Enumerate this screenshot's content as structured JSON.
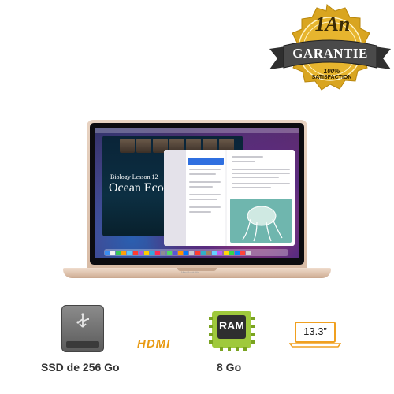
{
  "badge": {
    "years": "1An",
    "guarantee": "GARANTIE",
    "percent": "100%",
    "satisfaction": "SATISFACTION",
    "gold": "#d9a520",
    "ribbon": "#4a4a4a"
  },
  "laptop": {
    "model": "MacBook Air",
    "screen": {
      "lesson_small": "Biology Lesson 12",
      "lesson_big": "Ocean Eco"
    }
  },
  "specs": {
    "storage_label": "SSD de 256 Go",
    "storage_icon": "usb-drive-icon",
    "hdmi_label": "HDMI",
    "ram_chip_text": "RAM",
    "ram_label": "8 Go",
    "screen_size": "13.3”",
    "accent_orange": "#e89a12",
    "ram_green": "#9fc93c"
  }
}
